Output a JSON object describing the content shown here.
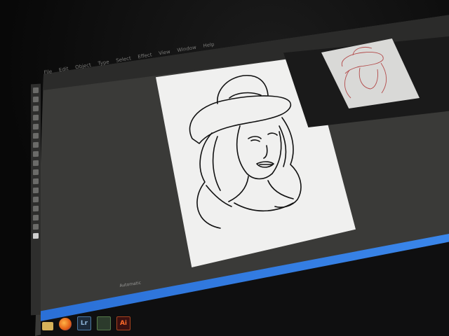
{
  "app": {
    "name": "Adobe Illustrator",
    "menu": [
      "File",
      "Edit",
      "Object",
      "Type",
      "Select",
      "Effect",
      "View",
      "Window",
      "Help"
    ]
  },
  "status": {
    "zoom_mode": "Automatic"
  },
  "taskbar": {
    "apps": [
      {
        "name": "folder-icon",
        "label": ""
      },
      {
        "name": "firefox-icon",
        "label": ""
      },
      {
        "name": "lightroom-icon",
        "label": "Lr"
      },
      {
        "name": "app-icon",
        "label": ""
      },
      {
        "name": "illustrator-icon",
        "label": "Ai"
      }
    ]
  },
  "colors": {
    "workspace": "#3a3a38",
    "artboard": "#f0f0ef",
    "taskbar_accent": "#2a6fd6"
  }
}
